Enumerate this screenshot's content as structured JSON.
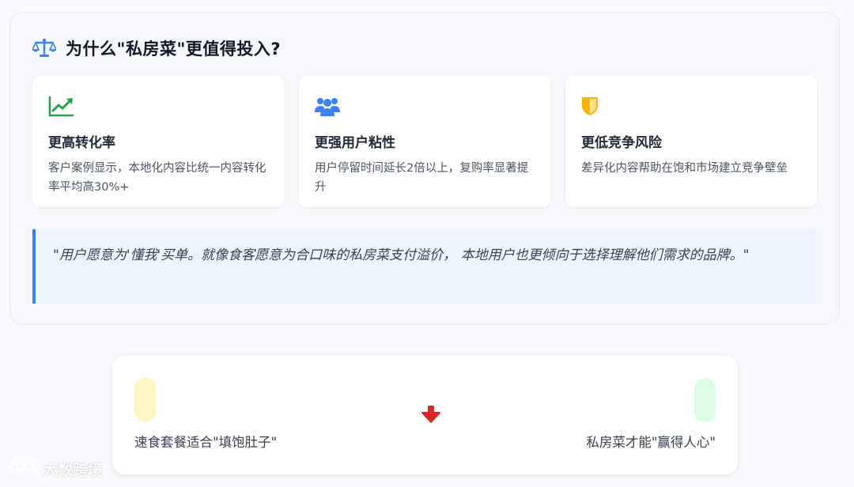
{
  "panel": {
    "title": "为什么\"私房菜\"更值得投入?",
    "title_icon": "balance-scale-icon"
  },
  "cards": [
    {
      "icon": "chart-line-icon",
      "icon_color": "#22a34a",
      "title": "更高转化率",
      "desc": "客户案例显示，本地化内容比统一内容转化率平均高30%+"
    },
    {
      "icon": "users-icon",
      "icon_color": "#3b82f6",
      "title": "更强用户粘性",
      "desc": "用户停留时间延长2倍以上，复购率显著提升"
    },
    {
      "icon": "shield-icon",
      "icon_color": "#f5b800",
      "title": "更低竞争风险",
      "desc": "差异化内容帮助在饱和市场建立竞争壁垒"
    }
  ],
  "quote": "\"用户愿意为'懂我'买单。就像食客愿意为合口味的私房菜支付溢价， 本地用户也更倾向于选择理解他们需求的品牌。\"",
  "comparison": {
    "left_label": "速食套餐适合\"填饱肚子\"",
    "right_label": "私房菜才能\"赢得人心\"",
    "arrow_icon": "arrow-down-icon",
    "arrow_color": "#dc2626"
  },
  "watermark": "大数跨境"
}
